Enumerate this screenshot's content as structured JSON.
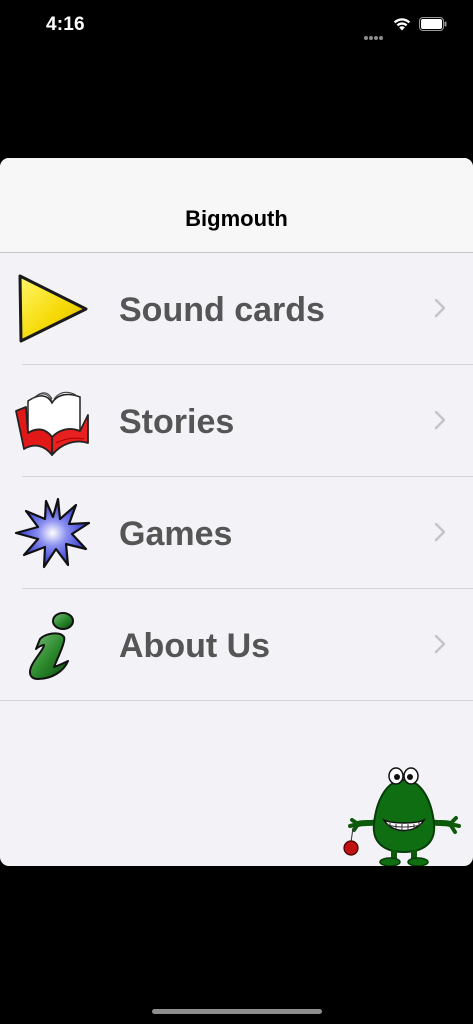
{
  "status_bar": {
    "time": "4:16",
    "icons": [
      "signal-dots-icon",
      "wifi-icon",
      "battery-icon"
    ]
  },
  "navbar": {
    "title": "Bigmouth"
  },
  "menu": {
    "items": [
      {
        "label": "Sound cards",
        "icon": "play-triangle-icon"
      },
      {
        "label": "Stories",
        "icon": "open-book-icon"
      },
      {
        "label": "Games",
        "icon": "starburst-icon"
      },
      {
        "label": "About Us",
        "icon": "info-icon"
      }
    ]
  },
  "mascot": {
    "icon": "green-monster-mascot-icon"
  },
  "colors": {
    "background": "#000000",
    "sheet": "#f2f2f7",
    "navbar": "#f7f7f7",
    "label": "#555555",
    "separator": "#d1d1d6",
    "chevron": "#c4c4c7"
  }
}
